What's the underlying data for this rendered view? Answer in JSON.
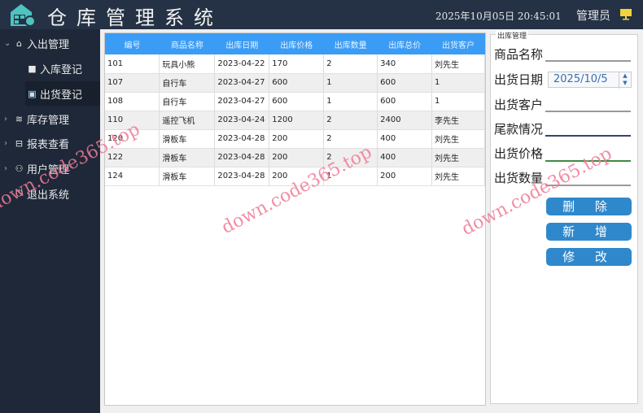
{
  "header": {
    "title": "仓库管理系统",
    "datetime": "2025年10月05日 20:45:01",
    "user": "管理员"
  },
  "sidebar": {
    "items": [
      {
        "label": "入出管理",
        "icon": "warehouse-icon"
      },
      {
        "label": "入库登记",
        "icon": "box-icon"
      },
      {
        "label": "出货登记",
        "icon": "outbox-icon"
      },
      {
        "label": "库存管理",
        "icon": "layers-icon"
      },
      {
        "label": "报表查看",
        "icon": "report-icon"
      },
      {
        "label": "用户管理",
        "icon": "users-icon"
      },
      {
        "label": "退出系统",
        "icon": "power-icon"
      }
    ]
  },
  "table": {
    "columns": [
      "编号",
      "商品名称",
      "出库日期",
      "出库价格",
      "出库数量",
      "出库总价",
      "出货客户"
    ],
    "rows": [
      [
        "101",
        "玩具小熊",
        "2023-04-22",
        "170",
        "2",
        "340",
        "刘先生"
      ],
      [
        "107",
        "自行车",
        "2023-04-27",
        "600",
        "1",
        "600",
        "1"
      ],
      [
        "108",
        "自行车",
        "2023-04-27",
        "600",
        "1",
        "600",
        "1"
      ],
      [
        "110",
        "遥控飞机",
        "2023-04-24",
        "1200",
        "2",
        "2400",
        "李先生"
      ],
      [
        "120",
        "滑板车",
        "2023-04-28",
        "200",
        "2",
        "400",
        "刘先生"
      ],
      [
        "122",
        "滑板车",
        "2023-04-28",
        "200",
        "2",
        "400",
        "刘先生"
      ],
      [
        "124",
        "滑板车",
        "2023-04-28",
        "200",
        "1",
        "200",
        "刘先生"
      ]
    ]
  },
  "form": {
    "title": "出库管理",
    "labels": [
      "商品名称",
      "出货日期",
      "出货客户",
      "尾款情况",
      "出货价格",
      "出货数量"
    ],
    "date": "2025/10/5",
    "buttons": {
      "delete": "删 除",
      "add": "新 增",
      "edit": "修 改"
    }
  },
  "watermark": "down.code365.top"
}
